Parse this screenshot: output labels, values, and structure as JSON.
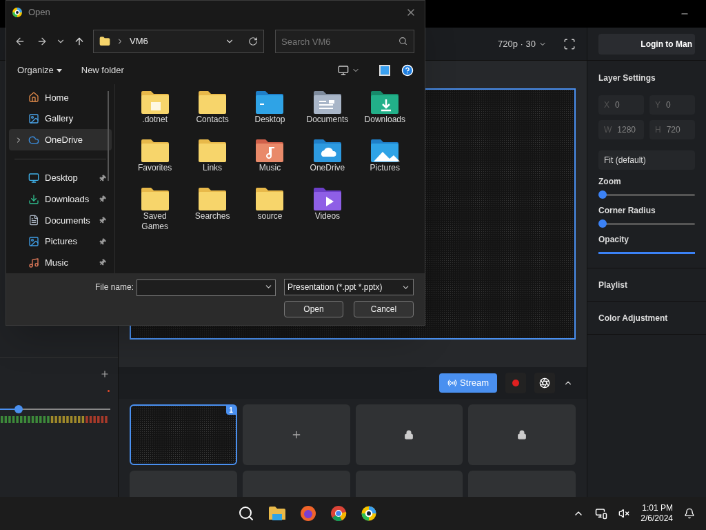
{
  "app": {
    "toolbar": {
      "resolution": "720p · 30"
    },
    "right_panel": {
      "login_button": "Login to Man",
      "title": "Layer Settings",
      "fields": [
        {
          "label": "X",
          "value": "0"
        },
        {
          "label": "Y",
          "value": "0"
        },
        {
          "label": "W",
          "value": "1280"
        },
        {
          "label": "H",
          "value": "720"
        }
      ],
      "fit_select": "Fit (default)",
      "sliders": [
        {
          "label": "Zoom",
          "level": 0,
          "thumb": true
        },
        {
          "label": "Corner Radius",
          "level": 0,
          "thumb": true
        },
        {
          "label": "Opacity",
          "level": 1,
          "thumb": false
        }
      ],
      "sections": [
        "Playlist",
        "Color Adjustment"
      ]
    },
    "audio": {
      "level": 0.14
    },
    "controls": {
      "stream": "Stream"
    },
    "scenes": [
      {
        "kind": "preview",
        "badge": "1",
        "selected": true
      },
      {
        "kind": "add",
        "selected": false
      },
      {
        "kind": "locked",
        "selected": false
      },
      {
        "kind": "locked",
        "selected": false
      },
      {
        "kind": "blank",
        "selected": false
      },
      {
        "kind": "blank",
        "selected": false
      },
      {
        "kind": "blank",
        "selected": false
      },
      {
        "kind": "blank",
        "selected": false
      }
    ]
  },
  "dialog": {
    "title": "Open",
    "path": "VM6",
    "search": {
      "placeholder": "Search VM6"
    },
    "commands": [
      "Organize",
      "New folder"
    ],
    "nav": [
      {
        "label": "Home",
        "kind": "home",
        "pinned": false,
        "selected": false,
        "expandable": false
      },
      {
        "label": "Gallery",
        "kind": "gallery",
        "pinned": false,
        "selected": false,
        "expandable": false
      },
      {
        "label": "OneDrive",
        "kind": "onedrive",
        "pinned": false,
        "selected": true,
        "expandable": true
      },
      {
        "label": "Desktop",
        "kind": "desktop",
        "pinned": true,
        "selected": false,
        "expandable": false
      },
      {
        "label": "Downloads",
        "kind": "downloads",
        "pinned": true,
        "selected": false,
        "expandable": false
      },
      {
        "label": "Documents",
        "kind": "documents",
        "pinned": true,
        "selected": false,
        "expandable": false
      },
      {
        "label": "Pictures",
        "kind": "pictures",
        "pinned": true,
        "selected": false,
        "expandable": false
      },
      {
        "label": "Music",
        "kind": "music",
        "pinned": true,
        "selected": false,
        "expandable": false
      }
    ],
    "folders": [
      {
        "label": ".dotnet",
        "kind": "dotnet"
      },
      {
        "label": "Contacts",
        "kind": "plain"
      },
      {
        "label": "Desktop",
        "kind": "desktop"
      },
      {
        "label": "Documents",
        "kind": "documents"
      },
      {
        "label": "Downloads",
        "kind": "downloads"
      },
      {
        "label": "Favorites",
        "kind": "plain"
      },
      {
        "label": "Links",
        "kind": "plain"
      },
      {
        "label": "Music",
        "kind": "music"
      },
      {
        "label": "OneDrive",
        "kind": "onedrive"
      },
      {
        "label": "Pictures",
        "kind": "pictures"
      },
      {
        "label": "Saved Games",
        "kind": "plain"
      },
      {
        "label": "Searches",
        "kind": "plain"
      },
      {
        "label": "source",
        "kind": "plain"
      },
      {
        "label": "Videos",
        "kind": "videos"
      }
    ],
    "file_name_label": "File name:",
    "filter": "Presentation (*.ppt *.pptx)",
    "buttons": [
      "Open",
      "Cancel"
    ]
  },
  "taskbar": {
    "time": "1:01 PM",
    "date": "2/6/2024"
  }
}
